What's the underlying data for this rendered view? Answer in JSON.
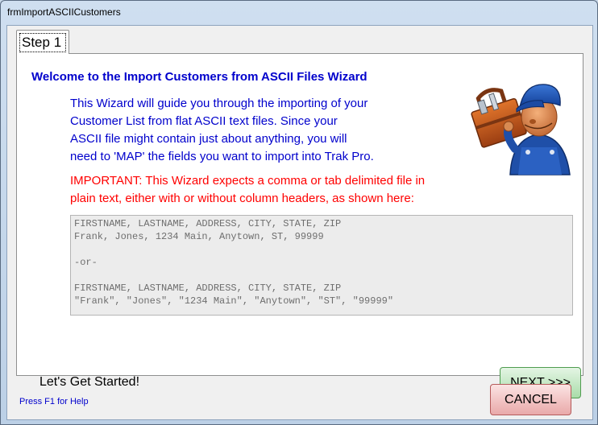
{
  "window": {
    "title": "frmImportASCIICustomers"
  },
  "tabs": [
    {
      "label": "Step 1"
    }
  ],
  "panel": {
    "heading": "Welcome to the Import Customers from ASCII Files Wizard",
    "intro_lines": [
      "This Wizard will guide you through the importing of your",
      "Customer List from flat ASCII text files.  Since your",
      "ASCII file might contain just about anything, you will",
      "need to 'MAP' the fields you want to import into Trak Pro."
    ],
    "important_lines": [
      "IMPORTANT: This Wizard expects a comma or tab delimited file in",
      "plain text, either with or without column headers, as shown here:"
    ],
    "example_lines": [
      "FIRSTNAME, LASTNAME, ADDRESS, CITY, STATE, ZIP",
      "Frank, Jones, 1234 Main, Anytown, ST, 99999",
      "",
      "-or-",
      "",
      "FIRSTNAME, LASTNAME, ADDRESS, CITY, STATE, ZIP",
      "\"Frank\", \"Jones\", \"1234 Main\", \"Anytown\", \"ST\", \"99999\""
    ],
    "get_started": "Let's Get Started!",
    "mascot_icon": "worker-with-toolbox-icon"
  },
  "buttons": {
    "next": "NEXT >>>",
    "cancel": "CANCEL"
  },
  "footer": {
    "help_text": "Press F1 for Help"
  },
  "colors": {
    "heading": "#0000cc",
    "intro": "#0000cc",
    "important": "#ff0000",
    "next_button": "#a9dca9",
    "cancel_button": "#e9a9a9"
  }
}
